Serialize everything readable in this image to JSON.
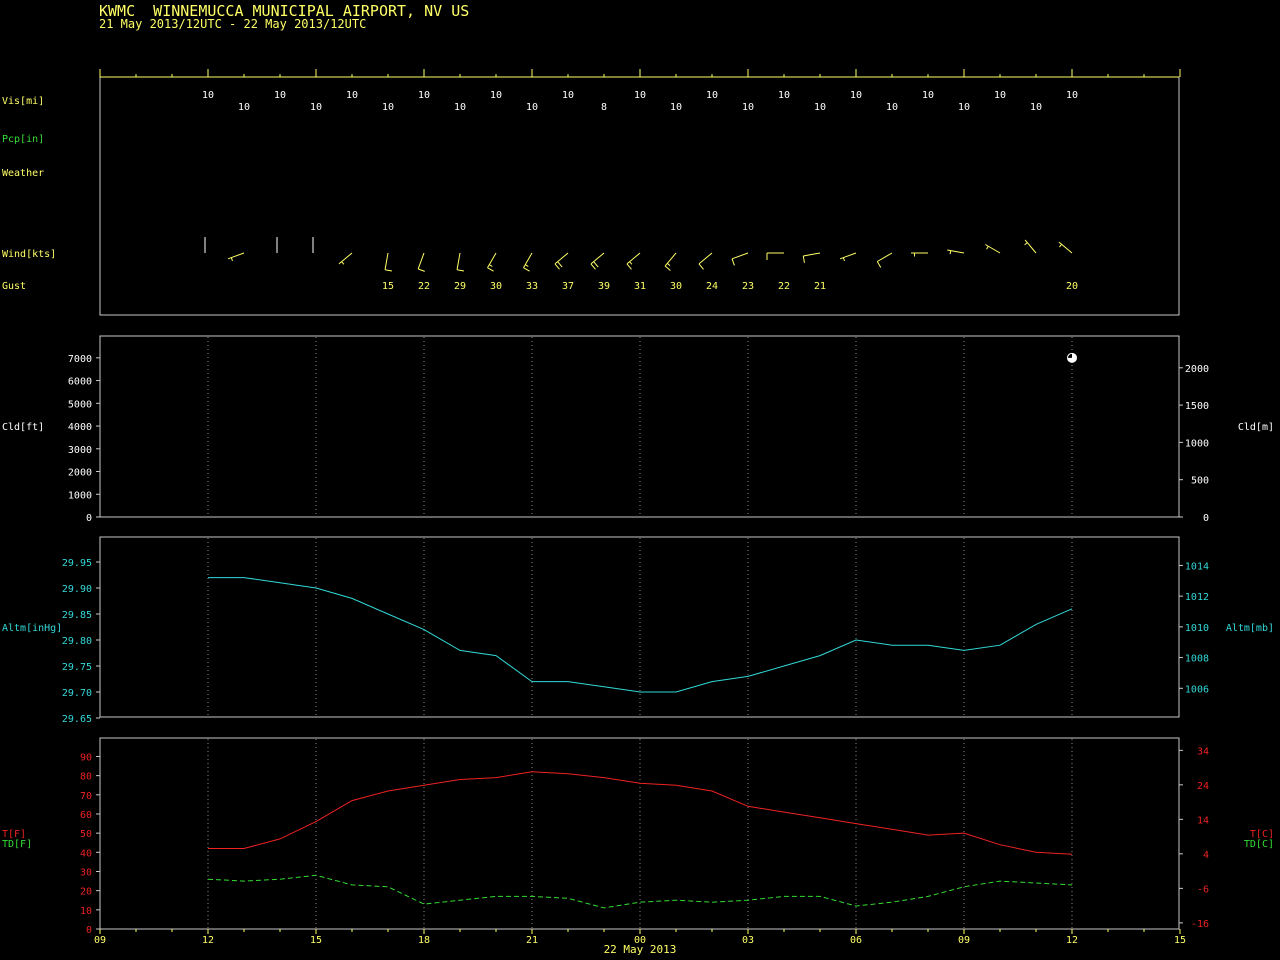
{
  "header": {
    "title": "KWMC  WINNEMUCCA MUNICIPAL AIRPORT, NV US",
    "subtitle": "21 May 2013/12UTC - 22 May 2013/12UTC"
  },
  "colors": {
    "frame": "#c8c8c8",
    "grid": "#8a8a8a",
    "yellow": "#ffff66",
    "green": "#33dd33",
    "cyan": "#33d8d8",
    "red": "#ee2222",
    "white": "#ffffff"
  },
  "chart_data": [
    {
      "type": "table",
      "panel": "surface-observations",
      "rows": {
        "vis": {
          "label": "Vis[mi]",
          "times": [
            12,
            13,
            14,
            15,
            16,
            17,
            18,
            19,
            20,
            21,
            22,
            23,
            0,
            1,
            2,
            3,
            4,
            5,
            6,
            7,
            8,
            9,
            10,
            11,
            12
          ],
          "values": [
            "10",
            "10",
            "10",
            "10",
            "10",
            "10",
            "10",
            "10",
            "10",
            "10",
            "10",
            "8",
            "10",
            "10",
            "10",
            "10",
            "10",
            "10",
            "10",
            "10",
            "10",
            "10",
            "10",
            "10",
            "10"
          ]
        },
        "pcp": {
          "label": "Pcp[in]"
        },
        "weather": {
          "label": "Weather"
        },
        "wind": {
          "label": "Wind[kts]",
          "hours": [
            0,
            1,
            2,
            3,
            4,
            5,
            6,
            7,
            8,
            9,
            10,
            11,
            12,
            13,
            14,
            15,
            16,
            17,
            18,
            19,
            20,
            21,
            22,
            23,
            24
          ],
          "direction_deg": [
            0,
            250,
            0,
            0,
            230,
            190,
            200,
            190,
            210,
            210,
            230,
            230,
            230,
            220,
            230,
            250,
            270,
            260,
            250,
            240,
            270,
            280,
            300,
            320,
            310
          ],
          "speed_kts": [
            0,
            5,
            0,
            0,
            5,
            10,
            10,
            10,
            15,
            15,
            20,
            20,
            15,
            15,
            10,
            10,
            10,
            10,
            5,
            10,
            5,
            5,
            5,
            5,
            5
          ]
        },
        "gust": {
          "label": "Gust",
          "times": [
            17,
            18,
            19,
            20,
            21,
            22,
            23,
            0,
            1,
            2,
            3,
            4,
            5,
            12
          ],
          "values": [
            "15",
            "22",
            "29",
            "30",
            "33",
            "37",
            "39",
            "31",
            "30",
            "24",
            "23",
            "22",
            "21",
            "20"
          ]
        }
      }
    },
    {
      "type": "scatter",
      "panel": "cloud",
      "ylabel": "Cld[ft]",
      "y2label": "Cld[m]",
      "ylim": [
        0,
        7500
      ],
      "yticks": [
        0,
        1000,
        2000,
        3000,
        4000,
        5000,
        6000,
        7000
      ],
      "y2ticks": [
        0,
        500,
        1000,
        1500,
        2000
      ],
      "points": [
        {
          "hour": 24,
          "height_ft": 7000,
          "cover": "broken"
        }
      ]
    },
    {
      "type": "line",
      "panel": "altimeter",
      "ylabel": "Altm[inHg]",
      "y2label": "Altm[mb]",
      "ylim": [
        29.65,
        29.98
      ],
      "yticks": [
        "29.65",
        "29.70",
        "29.75",
        "29.80",
        "29.85",
        "29.90",
        "29.95"
      ],
      "y2ticks": [
        "1006",
        "1008",
        "1010",
        "1012",
        "1014"
      ],
      "hours": [
        0,
        1,
        2,
        3,
        4,
        5,
        6,
        7,
        8,
        9,
        10,
        11,
        12,
        13,
        14,
        15,
        16,
        17,
        18,
        19,
        20,
        21,
        22,
        23,
        24
      ],
      "values": [
        29.92,
        29.92,
        29.91,
        29.9,
        29.88,
        29.85,
        29.82,
        29.78,
        29.77,
        29.72,
        29.72,
        29.71,
        29.7,
        29.7,
        29.72,
        29.73,
        29.75,
        29.77,
        29.8,
        29.79,
        29.79,
        29.78,
        29.79,
        29.83,
        29.86
      ]
    },
    {
      "type": "line",
      "panel": "temperature",
      "ylabel": "T[F]",
      "ylabel2": "TD[F]",
      "y2label": "T[C]",
      "y2label2": "TD[C]",
      "ylim": [
        0,
        96
      ],
      "yticks": [
        "0",
        "10",
        "20",
        "30",
        "40",
        "50",
        "60",
        "70",
        "80",
        "90"
      ],
      "y2ticks": [
        "-16",
        "-6",
        "4",
        "14",
        "24",
        "34"
      ],
      "xticks": [
        "09",
        "12",
        "15",
        "18",
        "21",
        "00",
        "03",
        "06",
        "09",
        "12",
        "15"
      ],
      "xlabel": "22 May 2013",
      "hours": [
        0,
        1,
        2,
        3,
        4,
        5,
        6,
        7,
        8,
        9,
        10,
        11,
        12,
        13,
        14,
        15,
        16,
        17,
        18,
        19,
        20,
        21,
        22,
        23,
        24
      ],
      "series": [
        {
          "name": "T[F]",
          "values": [
            42,
            42,
            47,
            56,
            67,
            72,
            75,
            78,
            79,
            82,
            81,
            79,
            76,
            75,
            72,
            64,
            61,
            58,
            55,
            52,
            49,
            50,
            44,
            40,
            39
          ]
        },
        {
          "name": "TD[F]",
          "values": [
            26,
            25,
            26,
            28,
            23,
            22,
            13,
            15,
            17,
            17,
            16,
            11,
            14,
            15,
            14,
            15,
            17,
            17,
            12,
            14,
            17,
            22,
            25,
            24,
            23
          ]
        }
      ]
    }
  ]
}
